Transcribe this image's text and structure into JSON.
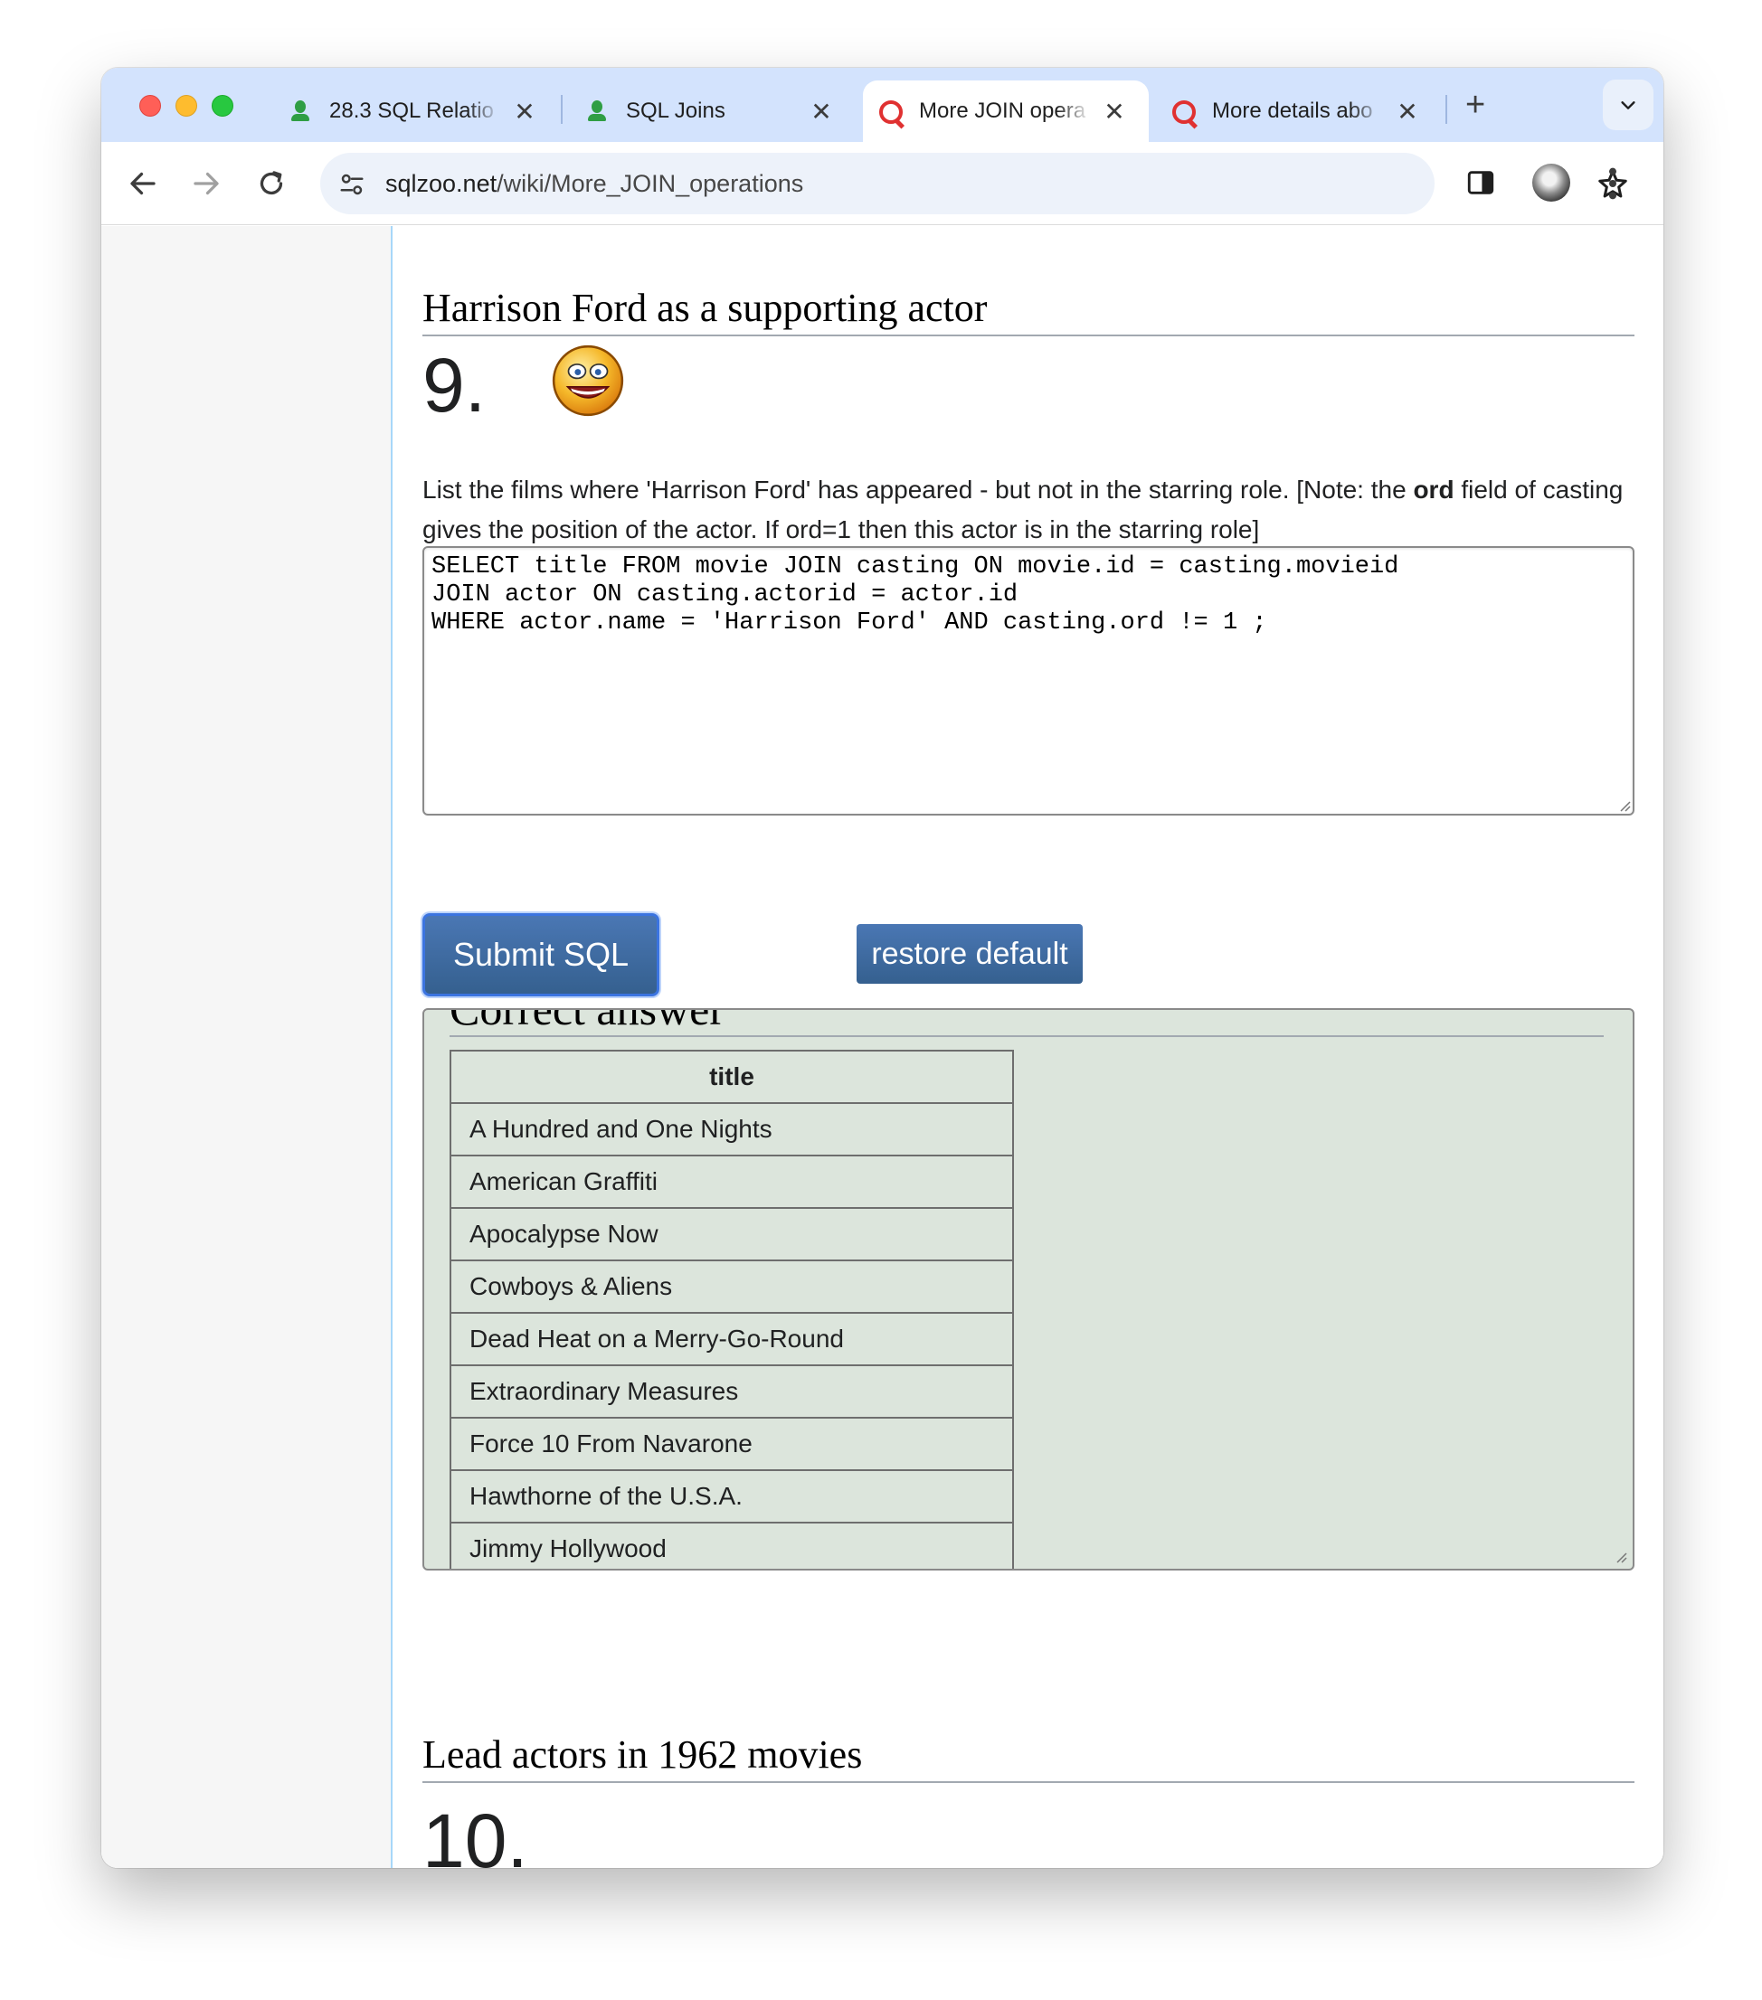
{
  "browser": {
    "tabs": [
      {
        "title": "28.3 SQL Relatio",
        "favicon": "green-person-icon",
        "active": false
      },
      {
        "title": "SQL Joins",
        "favicon": "green-person-icon",
        "active": false
      },
      {
        "title": "More JOIN opera",
        "favicon": "red-magnifier-icon",
        "active": true
      },
      {
        "title": "More details abo",
        "favicon": "red-magnifier-icon",
        "active": false
      }
    ],
    "tab_close_glyph": "✕",
    "new_tab_glyph": "+",
    "url_host": "sqlzoo.net",
    "url_path": "/wiki/More_JOIN_operations"
  },
  "page": {
    "section_9_heading": "Harrison Ford as a supporting actor",
    "question_number": "9.",
    "question_text_part1": "List the films where 'Harrison Ford' has appeared - but not in the starring role. [Note: the ",
    "question_text_bold": "ord",
    "question_text_part2": " field of casting gives the position of the actor. If ord=1 then this actor is in the starring role]",
    "sql_query": "SELECT title FROM movie JOIN casting ON movie.id = casting.movieid\nJOIN actor ON casting.actorid = actor.id\nWHERE actor.name = 'Harrison Ford' AND casting.ord != 1 ;",
    "submit_label": "Submit SQL",
    "restore_label": "restore default",
    "answer_title": "Correct answer",
    "result_header": "title",
    "result_rows": [
      "A Hundred and One Nights",
      "American Graffiti",
      "Apocalypse Now",
      "Cowboys & Aliens",
      "Dead Heat on a Merry-Go-Round",
      "Extraordinary Measures",
      "Force 10 From Navarone",
      "Hawthorne of the U.S.A.",
      "Jimmy Hollywood"
    ],
    "section_10_heading": "Lead actors in 1962 movies",
    "question_10_number": "10."
  },
  "colors": {
    "tabstrip_bg": "#d3e3fd",
    "button_bg": "#3e6aa3",
    "answer_bg": "#dce5dc",
    "sidebar_border": "#a7d7f9"
  }
}
